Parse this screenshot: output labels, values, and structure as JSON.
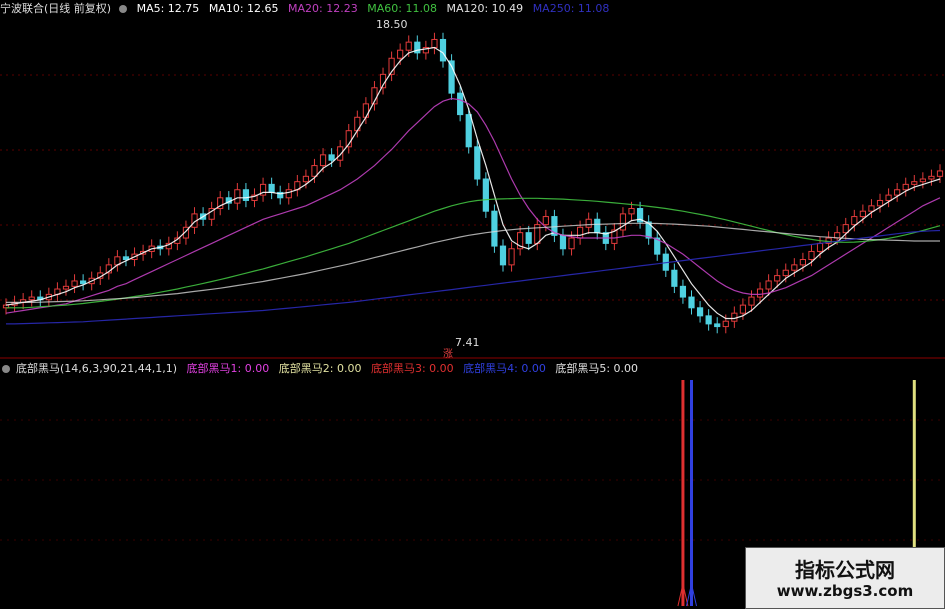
{
  "header": {
    "title": "宁波联合(日线 前复权)",
    "ma": [
      {
        "label": "MA5: 12.75",
        "color": "#ffffff"
      },
      {
        "label": "MA10: 12.65",
        "color": "#ffffff"
      },
      {
        "label": "MA20: 12.23",
        "color": "#c040c0"
      },
      {
        "label": "MA60: 11.08",
        "color": "#40c040"
      },
      {
        "label": "MA120: 10.49",
        "color": "#e0e0e0"
      },
      {
        "label": "MA250: 11.08",
        "color": "#3030c0"
      }
    ]
  },
  "indicator_header": {
    "title": "底部黑马(14,6,3,90,21,44,1,1)",
    "items": [
      {
        "label": "底部黑马1: 0.00",
        "color": "#e040e0"
      },
      {
        "label": "底部黑马2: 0.00",
        "color": "#e0e0a0"
      },
      {
        "label": "底部黑马3: 0.00",
        "color": "#e03030"
      },
      {
        "label": "底部黑马4: 0.00",
        "color": "#3040e0"
      },
      {
        "label": "底部黑马5: 0.00",
        "color": "#e0e0e0"
      }
    ]
  },
  "annotations": {
    "high_label": "18.50",
    "low_label": "7.41",
    "low_mark": "涨"
  },
  "watermark": {
    "line1": "指标公式网",
    "line2": "www.zbgs3.com"
  },
  "chart_data": {
    "type": "line",
    "price_range": [
      7.0,
      19.0
    ],
    "closes": [
      8.3,
      8.4,
      8.5,
      8.6,
      8.5,
      8.7,
      8.9,
      9.0,
      9.2,
      9.1,
      9.3,
      9.5,
      9.8,
      10.1,
      10.0,
      10.2,
      10.3,
      10.5,
      10.4,
      10.6,
      10.8,
      11.2,
      11.7,
      11.5,
      11.9,
      12.3,
      12.1,
      12.6,
      12.2,
      12.4,
      12.8,
      12.5,
      12.3,
      12.6,
      12.9,
      13.1,
      13.5,
      13.9,
      13.7,
      14.2,
      14.8,
      15.3,
      15.8,
      16.4,
      16.9,
      17.5,
      17.8,
      18.1,
      17.7,
      17.9,
      18.2,
      17.4,
      16.2,
      15.4,
      14.2,
      13.0,
      11.8,
      10.5,
      9.8,
      10.4,
      11.0,
      10.6,
      11.3,
      11.6,
      10.9,
      10.4,
      10.8,
      11.2,
      11.5,
      11.0,
      10.6,
      11.1,
      11.7,
      11.9,
      11.4,
      10.8,
      10.2,
      9.6,
      9.0,
      8.6,
      8.2,
      7.9,
      7.6,
      7.5,
      7.7,
      8.0,
      8.3,
      8.6,
      8.9,
      9.2,
      9.4,
      9.6,
      9.8,
      10.0,
      10.3,
      10.6,
      10.8,
      11.0,
      11.3,
      11.6,
      11.8,
      12.0,
      12.2,
      12.4,
      12.6,
      12.8,
      12.9,
      13.0,
      13.1,
      13.3
    ],
    "ma_series": [
      {
        "name": "MA5",
        "color": "#ffffff",
        "values": [
          8.3,
          8.35,
          8.4,
          8.45,
          8.5,
          8.6,
          8.7,
          8.8,
          8.95,
          9.05,
          9.2,
          9.35,
          9.55,
          9.8,
          9.95,
          10.1,
          10.25,
          10.4,
          10.45,
          10.55,
          10.75,
          11.05,
          11.4,
          11.6,
          11.8,
          12.0,
          12.15,
          12.3,
          12.3,
          12.35,
          12.5,
          12.5,
          12.45,
          12.5,
          12.6,
          12.8,
          13.05,
          13.4,
          13.6,
          13.9,
          14.3,
          14.8,
          15.3,
          15.9,
          16.5,
          17.0,
          17.4,
          17.7,
          17.8,
          17.85,
          17.9,
          17.7,
          17.2,
          16.5,
          15.6,
          14.5,
          13.5,
          12.4,
          11.3,
          10.7,
          10.5,
          10.4,
          10.6,
          10.9,
          11.0,
          10.9,
          10.9,
          10.9,
          11.0,
          11.0,
          10.95,
          11.05,
          11.25,
          11.45,
          11.5,
          11.35,
          11.05,
          10.6,
          10.1,
          9.6,
          9.1,
          8.7,
          8.3,
          8.0,
          7.8,
          7.8,
          7.9,
          8.1,
          8.4,
          8.7,
          9.0,
          9.3,
          9.5,
          9.7,
          9.9,
          10.2,
          10.45,
          10.65,
          10.95,
          11.25,
          11.5,
          11.75,
          11.95,
          12.15,
          12.35,
          12.55,
          12.7,
          12.8,
          12.9,
          13.0
        ]
      },
      {
        "name": "MA20",
        "color": "#c040c0",
        "values": [
          8.0,
          8.05,
          8.1,
          8.15,
          8.2,
          8.25,
          8.3,
          8.35,
          8.45,
          8.55,
          8.65,
          8.75,
          8.85,
          9.0,
          9.1,
          9.25,
          9.4,
          9.55,
          9.7,
          9.85,
          10.0,
          10.15,
          10.3,
          10.45,
          10.6,
          10.75,
          10.9,
          11.05,
          11.2,
          11.35,
          11.5,
          11.6,
          11.7,
          11.8,
          11.9,
          12.0,
          12.15,
          12.3,
          12.45,
          12.6,
          12.8,
          13.0,
          13.25,
          13.5,
          13.8,
          14.1,
          14.45,
          14.8,
          15.1,
          15.4,
          15.7,
          15.9,
          16.0,
          15.95,
          15.8,
          15.5,
          15.0,
          14.4,
          13.7,
          13.0,
          12.4,
          11.9,
          11.5,
          11.2,
          11.0,
          10.9,
          10.85,
          10.8,
          10.8,
          10.8,
          10.8,
          10.8,
          10.85,
          10.9,
          10.9,
          10.85,
          10.75,
          10.6,
          10.4,
          10.2,
          9.95,
          9.7,
          9.45,
          9.2,
          9.0,
          8.85,
          8.75,
          8.7,
          8.7,
          8.75,
          8.85,
          8.95,
          9.1,
          9.25,
          9.4,
          9.6,
          9.8,
          10.0,
          10.2,
          10.4,
          10.6,
          10.8,
          11.0,
          11.2,
          11.4,
          11.6,
          11.8,
          12.0,
          12.15,
          12.3
        ]
      },
      {
        "name": "MA60",
        "color": "#40c040",
        "values": [
          8.2,
          8.2,
          8.2,
          8.22,
          8.24,
          8.26,
          8.28,
          8.3,
          8.33,
          8.36,
          8.4,
          8.44,
          8.48,
          8.52,
          8.57,
          8.62,
          8.67,
          8.72,
          8.78,
          8.84,
          8.9,
          8.97,
          9.04,
          9.11,
          9.18,
          9.25,
          9.33,
          9.41,
          9.49,
          9.57,
          9.65,
          9.74,
          9.83,
          9.92,
          10.01,
          10.1,
          10.2,
          10.3,
          10.4,
          10.5,
          10.6,
          10.72,
          10.84,
          10.96,
          11.08,
          11.2,
          11.32,
          11.44,
          11.56,
          11.68,
          11.8,
          11.9,
          12.0,
          12.08,
          12.15,
          12.2,
          12.23,
          12.25,
          12.26,
          12.27,
          12.28,
          12.28,
          12.28,
          12.27,
          12.26,
          12.25,
          12.23,
          12.21,
          12.19,
          12.17,
          12.14,
          12.11,
          12.08,
          12.05,
          12.02,
          11.98,
          11.94,
          11.9,
          11.85,
          11.8,
          11.74,
          11.68,
          11.62,
          11.55,
          11.48,
          11.4,
          11.32,
          11.24,
          11.16,
          11.08,
          11.0,
          10.93,
          10.86,
          10.8,
          10.75,
          10.7,
          10.67,
          10.65,
          10.64,
          10.65,
          10.67,
          10.7,
          10.74,
          10.79,
          10.85,
          10.92,
          11.0,
          11.08,
          11.17,
          11.26
        ]
      },
      {
        "name": "MA120",
        "color": "#e0e0e0",
        "values": [
          8.4,
          8.4,
          8.4,
          8.4,
          8.41,
          8.42,
          8.43,
          8.44,
          8.45,
          8.46,
          8.48,
          8.5,
          8.52,
          8.54,
          8.56,
          8.58,
          8.61,
          8.64,
          8.67,
          8.7,
          8.73,
          8.77,
          8.81,
          8.85,
          8.89,
          8.93,
          8.98,
          9.03,
          9.08,
          9.13,
          9.18,
          9.24,
          9.3,
          9.36,
          9.42,
          9.48,
          9.55,
          9.62,
          9.69,
          9.76,
          9.83,
          9.91,
          9.99,
          10.07,
          10.15,
          10.23,
          10.31,
          10.39,
          10.47,
          10.55,
          10.63,
          10.7,
          10.77,
          10.84,
          10.9,
          10.95,
          11.0,
          11.04,
          11.08,
          11.11,
          11.14,
          11.16,
          11.18,
          11.2,
          11.22,
          11.24,
          11.26,
          11.28,
          11.3,
          11.31,
          11.32,
          11.33,
          11.34,
          11.35,
          11.35,
          11.35,
          11.34,
          11.33,
          11.32,
          11.3,
          11.28,
          11.26,
          11.24,
          11.21,
          11.18,
          11.15,
          11.12,
          11.09,
          11.06,
          11.03,
          11.0,
          10.97,
          10.94,
          10.91,
          10.88,
          10.85,
          10.83,
          10.81,
          10.79,
          10.77,
          10.75,
          10.74,
          10.73,
          10.72,
          10.71,
          10.7,
          10.69,
          10.69,
          10.69,
          10.69
        ]
      },
      {
        "name": "MA250",
        "color": "#2a2ab8",
        "values": [
          7.6,
          7.6,
          7.61,
          7.62,
          7.63,
          7.64,
          7.65,
          7.66,
          7.67,
          7.68,
          7.7,
          7.72,
          7.74,
          7.76,
          7.78,
          7.8,
          7.82,
          7.84,
          7.86,
          7.88,
          7.9,
          7.92,
          7.94,
          7.96,
          7.98,
          8.0,
          8.02,
          8.04,
          8.06,
          8.08,
          8.1,
          8.13,
          8.16,
          8.19,
          8.22,
          8.25,
          8.28,
          8.31,
          8.34,
          8.37,
          8.4,
          8.44,
          8.48,
          8.52,
          8.56,
          8.6,
          8.64,
          8.68,
          8.72,
          8.76,
          8.8,
          8.84,
          8.88,
          8.92,
          8.96,
          9.0,
          9.04,
          9.08,
          9.12,
          9.16,
          9.2,
          9.24,
          9.28,
          9.32,
          9.36,
          9.4,
          9.44,
          9.48,
          9.52,
          9.56,
          9.6,
          9.64,
          9.68,
          9.72,
          9.76,
          9.8,
          9.84,
          9.88,
          9.92,
          9.96,
          10.0,
          10.04,
          10.08,
          10.12,
          10.16,
          10.2,
          10.24,
          10.28,
          10.32,
          10.36,
          10.4,
          10.44,
          10.48,
          10.52,
          10.56,
          10.6,
          10.64,
          10.68,
          10.72,
          10.76,
          10.8,
          10.84,
          10.88,
          10.92,
          10.96,
          11.0,
          11.03,
          11.05,
          11.07,
          11.08
        ]
      }
    ],
    "signals": [
      {
        "name": "底部黑马3",
        "color": "#e03030",
        "index": 79
      },
      {
        "name": "底部黑马4",
        "color": "#3040e0",
        "index": 80
      },
      {
        "name": "底部黑马2",
        "color": "#e0e080",
        "index": 106
      }
    ]
  }
}
